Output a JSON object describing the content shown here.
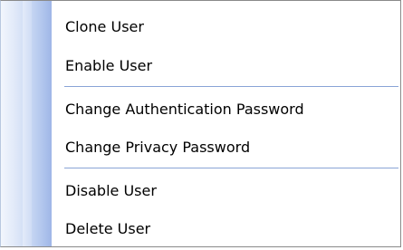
{
  "context_menu": {
    "items": [
      {
        "label": "Clone User"
      },
      {
        "label": "Enable User"
      },
      {
        "label": "Change Authentication Password"
      },
      {
        "label": "Change Privacy Password"
      },
      {
        "label": "Disable User"
      },
      {
        "label": "Delete User"
      }
    ]
  }
}
